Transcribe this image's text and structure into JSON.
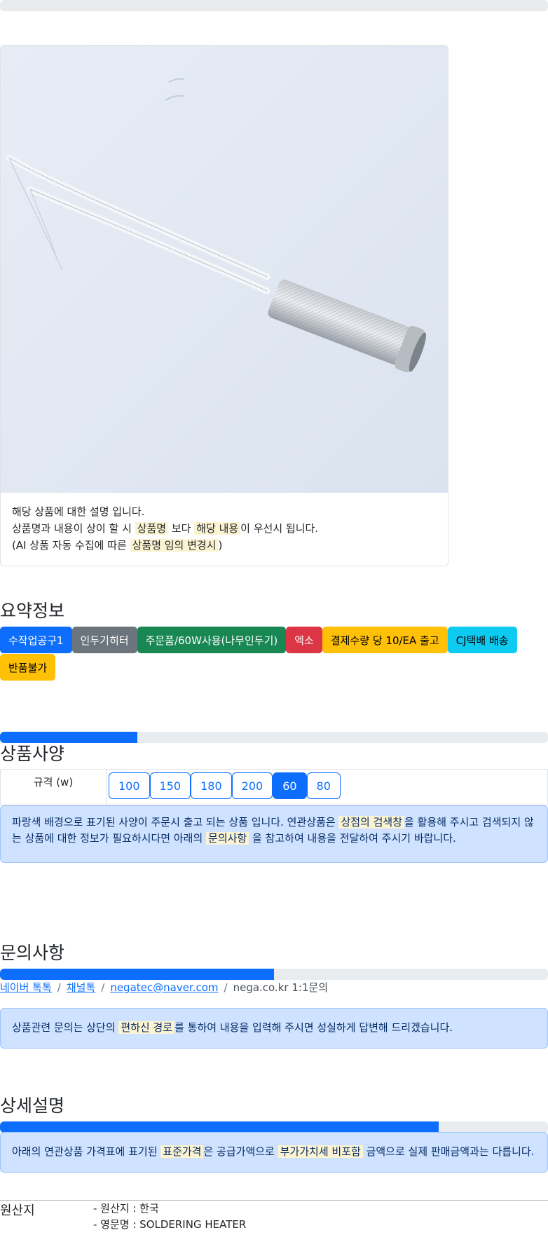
{
  "progress_bars": {
    "top": 0.0,
    "specs": 0.25,
    "inquiry": 0.5,
    "detail": 0.8
  },
  "product_card": {
    "image_alt": "soldering heater product photo",
    "desc_line1": "해당 상품에 대한 설명 입니다.",
    "desc_line2_pre": "상품명과 내용이 상이 할 시 ",
    "desc_line2_mark1": "상품명",
    "desc_line2_mid": " 보다 ",
    "desc_line2_mark2": "해당 내용",
    "desc_line2_post": "이 우선시 됩니다.",
    "desc_line3_pre": "(AI 상품 자동 수집에 따른 ",
    "desc_line3_mark": "상품명 임의 변경시",
    "desc_line3_post": ")"
  },
  "summary": {
    "title": "요약정보",
    "badges": [
      {
        "label": "수작업공구1",
        "style": "primary"
      },
      {
        "label": "인두기히터",
        "style": "secondary"
      },
      {
        "label": "주문품/60W사용(나무인두기)",
        "style": "success"
      },
      {
        "label": "엑소",
        "style": "danger"
      },
      {
        "label": "결제수량 당 10/EA 출고",
        "style": "warning"
      },
      {
        "label": "CJ택배 배송",
        "style": "info"
      },
      {
        "label": "반품불가",
        "style": "warning"
      }
    ]
  },
  "specs": {
    "title": "상품사양",
    "label": "규격 (w)",
    "options": [
      "100",
      "150",
      "180",
      "200",
      "60",
      "80"
    ],
    "selected": "60",
    "notice_pre": "파랑색 배경으로 표기된 사양이 주문시 출고 되는 상품 입니다. 연관상품은 ",
    "notice_mark1": "상점의 검색창",
    "notice_mid": "을 활용해 주시고 검색되지 않는 상품에 대한 정보가 필요하시다면 아래의 ",
    "notice_mark2": "문의사항",
    "notice_post": " 을 참고하여 내용을 전달하여 주시기 바랍니다."
  },
  "inquiry": {
    "title": "문의사항",
    "links": [
      "네이버 톡톡",
      "채널톡",
      "negatec@naver.com"
    ],
    "site_text": "nega.co.kr 1:1문의",
    "separator": "/",
    "notice_pre": "상품관련 문의는 상단의 ",
    "notice_mark": "편하신 경로",
    "notice_post": "를 통하여 내용을 입력해 주시면 성실하게 답변해 드리겠습니다."
  },
  "detail": {
    "title": "상세설명",
    "notice_pre": "아래의 연관상품 가격표에 표기된 ",
    "notice_mark1": "표준가격",
    "notice_mid": "은 공급가액으로 ",
    "notice_mark2": "부가가치세 비포함",
    "notice_post": " 금액으로 실제 판매금액과는 다릅니다."
  },
  "origin": {
    "label": "원산지",
    "country": "- 원산지 : 한국",
    "english_name": "- 영문명 : SOLDERING HEATER"
  },
  "colors": {
    "primary": "#0d6efd",
    "alert_bg": "#cfe2ff",
    "highlight": "#fcf3d2"
  }
}
